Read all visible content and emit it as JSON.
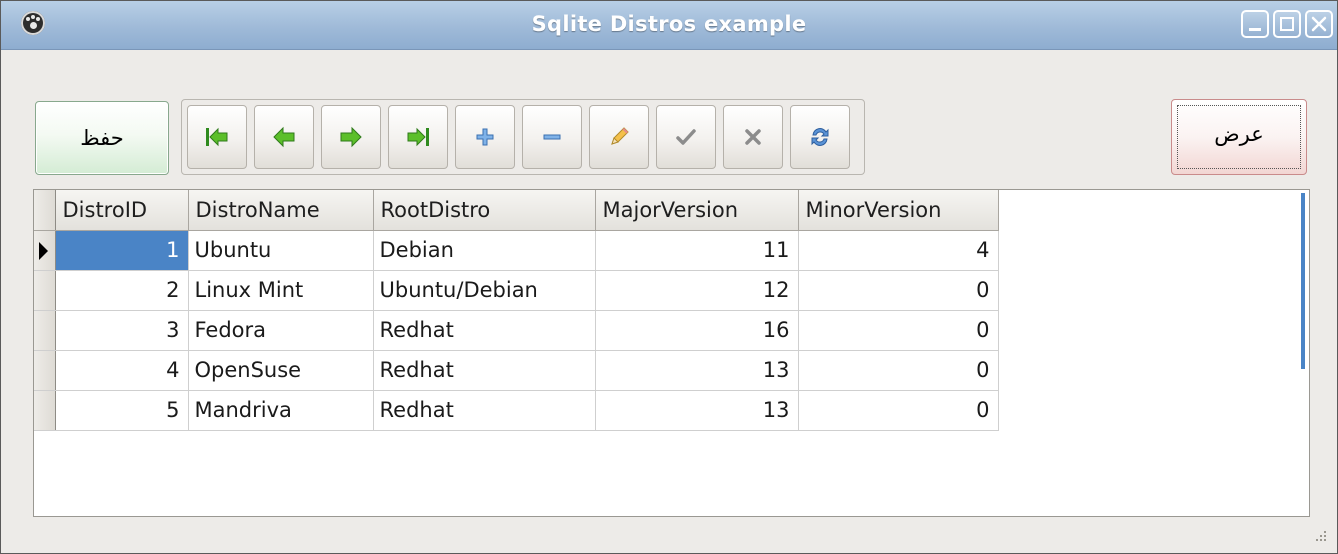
{
  "window": {
    "title": "Sqlite Distros example",
    "title_color": "#ffffff",
    "titlebar_color": "#9fbad8"
  },
  "buttons": {
    "save_label": "حفظ",
    "show_label": "عرض"
  },
  "navigator": {
    "items": [
      {
        "icon": "first-record-icon"
      },
      {
        "icon": "prior-record-icon"
      },
      {
        "icon": "next-record-icon"
      },
      {
        "icon": "last-record-icon"
      },
      {
        "icon": "insert-icon"
      },
      {
        "icon": "delete-icon"
      },
      {
        "icon": "edit-icon"
      },
      {
        "icon": "post-icon"
      },
      {
        "icon": "cancel-icon"
      },
      {
        "icon": "refresh-icon"
      }
    ]
  },
  "grid": {
    "columns": [
      "DistroID",
      "DistroName",
      "RootDistro",
      "MajorVersion",
      "MinorVersion"
    ],
    "rows": [
      {
        "id": "1",
        "name": "Ubuntu",
        "root": "Debian",
        "major": "11",
        "minor": "4"
      },
      {
        "id": "2",
        "name": "Linux Mint",
        "root": "Ubuntu/Debian",
        "major": "12",
        "minor": "0"
      },
      {
        "id": "3",
        "name": "Fedora",
        "root": "Redhat",
        "major": "16",
        "minor": "0"
      },
      {
        "id": "4",
        "name": "OpenSuse",
        "root": "Redhat",
        "major": "13",
        "minor": "0"
      },
      {
        "id": "5",
        "name": "Mandriva",
        "root": "Redhat",
        "major": "13",
        "minor": "0"
      }
    ],
    "selection_color": "#4a84c6"
  }
}
